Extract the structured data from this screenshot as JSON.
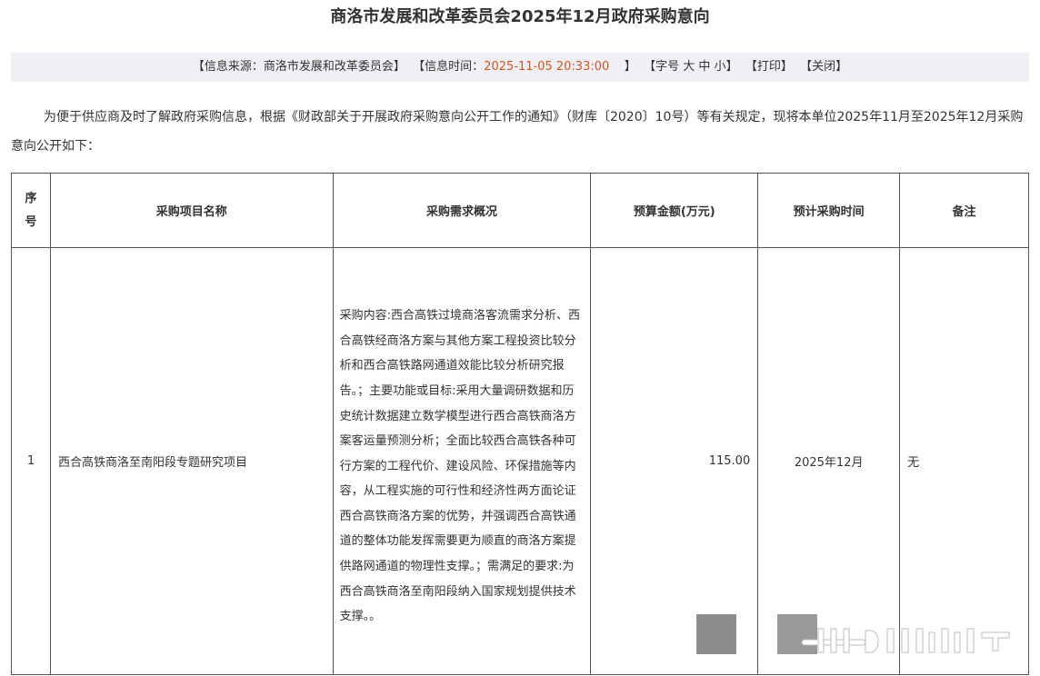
{
  "title": "商洛市发展和改革委员会2025年12月政府采购意向",
  "info": {
    "source_prefix": "【信息来源：",
    "source_value": "商洛市发展和改革委员会",
    "source_suffix": "】",
    "time_prefix": "【信息时间：",
    "time_value": "2025-11-05 20:33:00",
    "time_suffix": "】",
    "font_prefix": "【字号",
    "font_large": "大",
    "font_medium": "中",
    "font_small": "小",
    "font_suffix": "】",
    "print": "【打印】",
    "close": "【关闭】"
  },
  "intro": "为便于供应商及时了解政府采购信息，根据《财政部关于开展政府采购意向公开工作的通知》（财库〔2020〕10号）等有关规定，现将本单位2025年11月至2025年12月采购意向公开如下：",
  "table": {
    "headers": {
      "seq_line1": "序",
      "seq_line2": "号",
      "name": "采购项目名称",
      "desc": "采购需求概况",
      "budget": "预算金额(万元)",
      "time": "预计采购时间",
      "note": "备注"
    },
    "rows": [
      {
        "seq": "1",
        "name": "西合高铁商洛至南阳段专题研究项目",
        "desc": "采购内容:西合高铁过境商洛客流需求分析、西合高铁经商洛方案与其他方案工程投资比较分析和西合高铁路网通道效能比较分析研究报告。；主要功能或目标:采用大量调研数据和历史统计数据建立数学模型进行西合高铁商洛方案客运量预测分析；全面比较西合高铁各种可行方案的工程代价、建设风险、环保措施等内容，从工程实施的可行性和经济性两方面论证西合高铁商洛方案的优势，并强调西合高铁通道的整体功能发挥需要更为顺直的商洛方案提供路网通道的物理性支撑。；需满足的要求:为西合高铁商洛至南阳段纳入国家规划提供技术支撑。。",
        "budget": "115.00",
        "time": "2025年12月",
        "note": "无"
      }
    ]
  }
}
